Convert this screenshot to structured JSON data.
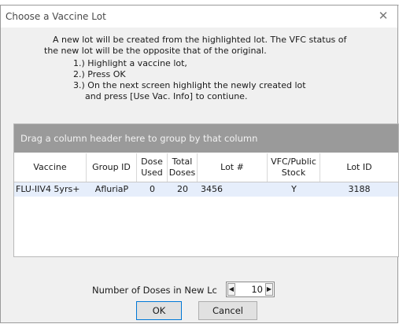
{
  "dialog": {
    "title": "Choose a Vaccine Lot",
    "close_glyph": "✕"
  },
  "instructions": {
    "line1": "A new lot will be created from the highlighted lot. The VFC status of",
    "line2": "the new lot will be the opposite that of the original.",
    "step1": "1.) Highlight a vaccine lot,",
    "step2": "2.) Press OK",
    "step3": "3.) On the next screen highlight the newly created lot",
    "step4": "and press [Use Vac. Info] to  contiune."
  },
  "grid": {
    "group_panel_text": "Drag a column header here to group by that column",
    "headers": {
      "vaccine": "Vaccine",
      "group_id": "Group ID",
      "dose_used": "Dose\nUsed",
      "total_doses": "Total\nDoses",
      "lot_num": "Lot #",
      "vfc_stock": "VFC/Public\nStock",
      "lot_id": "Lot ID"
    },
    "rows": [
      {
        "vaccine": "FLU-IIV4 5yrs+",
        "group_id": "AfluriaP",
        "dose_used": "0",
        "total_doses": "20",
        "lot_num": "3456",
        "vfc_stock": "Y",
        "lot_id": "3188"
      }
    ]
  },
  "doses": {
    "label": "Number of Doses in New Lc",
    "value": "10",
    "left_arrow": "◀",
    "right_arrow": "▶"
  },
  "buttons": {
    "ok": "OK",
    "cancel": "Cancel"
  },
  "colors": {
    "group_panel": "#9a9a9a",
    "selected_row": "#e6eefb",
    "dialog_bg": "#f0f0f0"
  }
}
